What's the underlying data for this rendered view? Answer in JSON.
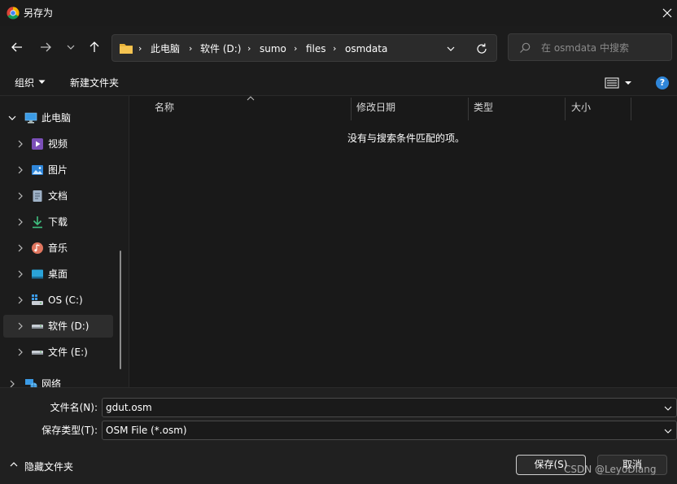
{
  "window": {
    "title": "另存为"
  },
  "address": {
    "crumbs": [
      "此电脑",
      "软件 (D:)",
      "sumo",
      "files",
      "osmdata"
    ]
  },
  "search": {
    "placeholder": "在 osmdata 中搜索"
  },
  "toolbar": {
    "organize_label": "组织",
    "new_folder_label": "新建文件夹",
    "help_label": "?"
  },
  "sidebar": {
    "items": [
      {
        "label": "此电脑",
        "icon": "computer-icon"
      },
      {
        "label": "视频",
        "icon": "video-icon"
      },
      {
        "label": "图片",
        "icon": "picture-icon"
      },
      {
        "label": "文档",
        "icon": "document-icon"
      },
      {
        "label": "下载",
        "icon": "download-icon"
      },
      {
        "label": "音乐",
        "icon": "music-icon"
      },
      {
        "label": "桌面",
        "icon": "desktop-icon"
      },
      {
        "label": "OS (C:)",
        "icon": "drive-c-icon"
      },
      {
        "label": "软件 (D:)",
        "icon": "drive-icon"
      },
      {
        "label": "文件 (E:)",
        "icon": "drive-icon"
      },
      {
        "label": "网络",
        "icon": "network-icon"
      }
    ]
  },
  "columns": {
    "name": "名称",
    "modified": "修改日期",
    "type": "类型",
    "size": "大小"
  },
  "content": {
    "empty_message": "没有与搜索条件匹配的项。"
  },
  "form": {
    "filename_label": "文件名(N):",
    "filename_value": "gdut.osm",
    "filetype_label": "保存类型(T):",
    "filetype_value": "OSM File (*.osm)"
  },
  "footer": {
    "hide_folders_label": "隐藏文件夹",
    "save_label": "保存(S)",
    "cancel_label": "取消",
    "watermark": "CSDN @LeyoDiang"
  },
  "colors": {
    "accent": "#2f86d9",
    "folder": "#e8b23a"
  }
}
